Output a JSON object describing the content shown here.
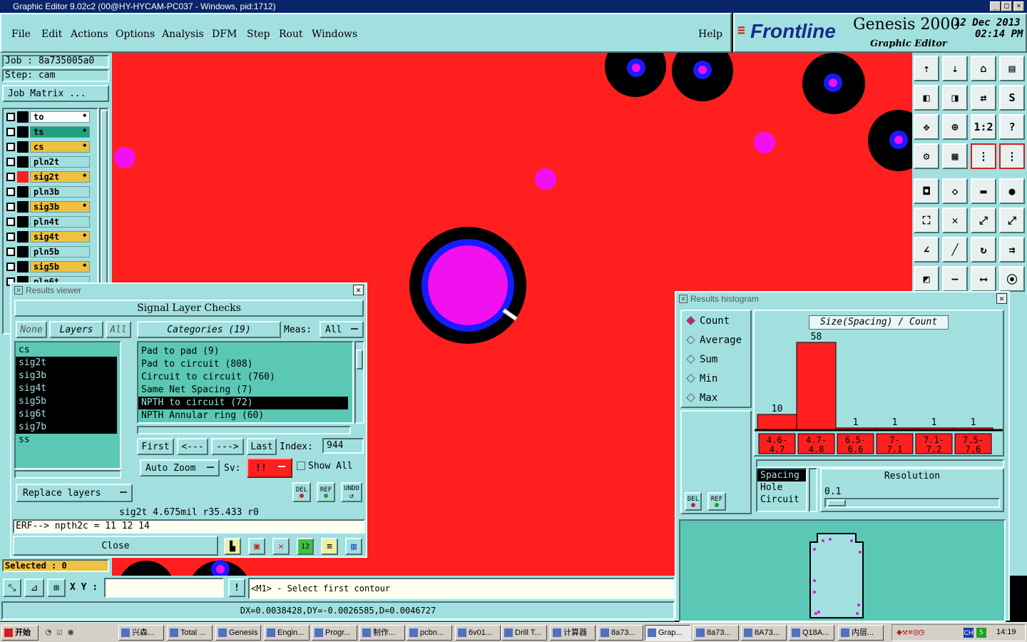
{
  "window": {
    "title": "Graphic Editor 9.02c2 (00@HY-HYCAM-PC037 - Windows, pid:1712)",
    "controls": [
      "_",
      "□",
      "×"
    ]
  },
  "menu": {
    "items": [
      "File",
      "Edit",
      "Actions",
      "Options",
      "Analysis",
      "DFM",
      "Step",
      "Rout",
      "Windows"
    ],
    "help": "Help"
  },
  "brand": {
    "logo": "Frontline",
    "product": "Genesis 2000",
    "subtitle": "Graphic Editor",
    "date": "12 Dec 2013",
    "time": "02:14 PM"
  },
  "job": {
    "job_label": "Job  : 8a735005a0",
    "step_label": "Step: cam",
    "matrix_button": "Job Matrix ...",
    "layers": [
      {
        "name": "to",
        "color": "#ffffff",
        "arrow": true
      },
      {
        "name": "ts",
        "color": "#20a080",
        "arrow": true
      },
      {
        "name": "cs",
        "color": "#f0c040",
        "arrow": true
      },
      {
        "name": "pln2t",
        "color": "#a2e0e0",
        "arrow": false
      },
      {
        "name": "sig2t",
        "color": "#f0c040",
        "arrow": true,
        "swatch": "#ff1f1f"
      },
      {
        "name": "pln3b",
        "color": "#a2e0e0",
        "arrow": false
      },
      {
        "name": "sig3b",
        "color": "#f0c040",
        "arrow": true
      },
      {
        "name": "pln4t",
        "color": "#a2e0e0",
        "arrow": false
      },
      {
        "name": "sig4t",
        "color": "#f0c040",
        "arrow": true
      },
      {
        "name": "pln5b",
        "color": "#a2e0e0",
        "arrow": false
      },
      {
        "name": "sig5b",
        "color": "#f0c040",
        "arrow": true
      },
      {
        "name": "pln6t",
        "color": "#a2e0e0",
        "arrow": false
      }
    ],
    "selected": "Selected : 0"
  },
  "results_viewer": {
    "title": "Results viewer",
    "header": "Signal Layer Checks",
    "none_btn": "None",
    "layers_btn": "Layers",
    "all_btn": "All",
    "categories_btn": "Categories (19)",
    "meas_label": "Meas:",
    "meas_value": "All",
    "layer_list": [
      {
        "name": "cs",
        "sel": false
      },
      {
        "name": "sig2t",
        "sel": true
      },
      {
        "name": "sig3b",
        "sel": true
      },
      {
        "name": "sig4t",
        "sel": true
      },
      {
        "name": "sig5b",
        "sel": true
      },
      {
        "name": "sig6t",
        "sel": true
      },
      {
        "name": "sig7b",
        "sel": true
      },
      {
        "name": "ss",
        "sel": false
      }
    ],
    "categories": [
      {
        "name": "Pad to pad (9)",
        "sel": false
      },
      {
        "name": "Pad to circuit (808)",
        "sel": false
      },
      {
        "name": "Circuit to circuit (760)",
        "sel": false
      },
      {
        "name": "Same Net Spacing (7)",
        "sel": false
      },
      {
        "name": "NPTH to circuit (72)",
        "sel": true
      },
      {
        "name": "NPTH Annular ring (60)",
        "sel": false
      }
    ],
    "nav": {
      "first": "First",
      "prev": "<---",
      "next": "--->",
      "last": "Last",
      "index_label": "Index:",
      "index_value": "944"
    },
    "auto_zoom": "Auto Zoom",
    "sv_label": "Sv:",
    "sv_value": "!!",
    "show_all": "Show All",
    "replace_layers": "Replace layers",
    "icon_del": "DEL",
    "icon_ref": "REF",
    "icon_undo": "UNDO",
    "info": "sig2t 4.675mil  r35.433  r0",
    "erf": "ERF--> npth2c = 11 12 14",
    "close": "Close"
  },
  "histogram": {
    "title": "Results histogram",
    "modes": [
      {
        "name": "Count",
        "on": true
      },
      {
        "name": "Average",
        "on": false
      },
      {
        "name": "Sum",
        "on": false
      },
      {
        "name": "Min",
        "on": false
      },
      {
        "name": "Max",
        "on": false
      }
    ],
    "chart_title": "Size(Spacing) / Count",
    "bars": [
      {
        "label": "4.6-4.7",
        "count": 10
      },
      {
        "label": "4.7-4.8",
        "count": 58
      },
      {
        "label": "6.5-6.6",
        "count": 1
      },
      {
        "label": "7-7.1",
        "count": 1
      },
      {
        "label": "7.1-7.2",
        "count": 1
      },
      {
        "label": "7.5-7.6",
        "count": 1
      }
    ],
    "types": [
      "Spacing",
      "Hole",
      "Circuit"
    ],
    "resolution_label": "Resolution",
    "resolution_value": "0.1",
    "icon_del": "DEL",
    "icon_ref": "REF"
  },
  "status": {
    "xy_label": "X Y :",
    "xy_value": "",
    "prompt": "<M1> - Select first contour",
    "measure": "DX=0.0038428,DY=-0.0026585,D=0.0046727"
  },
  "toolbar_icons": [
    "open-icon",
    "save-icon",
    "home-icon",
    "window-icon",
    "pan-left-icon",
    "pan-right-icon",
    "zoom-10-icon",
    "snap-icon",
    "fit-icon",
    "center-icon",
    "scale-icon",
    "help-icon",
    "settings-icon",
    "grid-icon",
    "net-icon",
    "net2-icon",
    "feature-icon",
    "draw-icon",
    "ruler-icon",
    "dot-icon",
    "nodes-icon",
    "cross-icon",
    "line-icon",
    "line2-icon",
    "angle-icon",
    "slash-icon",
    "arc-icon",
    "text-icon",
    "pad-icon",
    "minus-icon",
    "measure-icon",
    "ring-icon"
  ],
  "taskbar": {
    "start": "开始",
    "tasks": [
      "兴森...",
      "Total ...",
      "Genesis",
      "Engin...",
      "Progr...",
      "制作...",
      "pcbn...",
      "6v01...",
      "Drill T...",
      "计算器",
      "8a73...",
      "Grap...",
      "8a73...",
      "8A73...",
      "Q18A...",
      "内层..."
    ],
    "clock": "14:19"
  }
}
